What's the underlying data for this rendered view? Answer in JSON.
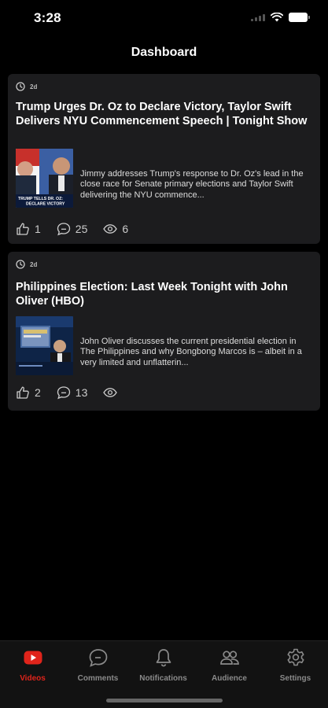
{
  "status_bar": {
    "time": "3:28"
  },
  "header": {
    "title": "Dashboard"
  },
  "videos": [
    {
      "age": "2d",
      "title": "Trump Urges Dr. Oz to Declare Victory, Taylor Swift Delivers NYU Commencement Speech | Tonight Show",
      "description": "Jimmy addresses Trump's response to Dr. Oz's lead in the close race for Senate primary elections and Taylor Swift delivering the NYU commence...",
      "thumbnail_caption": "TRUMP TELLS DR. OZ: DECLARE VICTORY",
      "likes": "1",
      "comments": "25",
      "views": "6"
    },
    {
      "age": "2d",
      "title": "Philippines Election: Last Week Tonight with John Oliver (HBO)",
      "description": "John Oliver discusses the current presidential election in The Philippines and why Bongbong Marcos is – albeit in a very limited and unflatterin...",
      "likes": "2",
      "comments": "13",
      "views": ""
    }
  ],
  "tabs": [
    {
      "label": "Videos",
      "icon": "youtube-icon",
      "active": true
    },
    {
      "label": "Comments",
      "icon": "comment-bubble-icon",
      "active": false
    },
    {
      "label": "Notifications",
      "icon": "bell-icon",
      "active": false
    },
    {
      "label": "Audience",
      "icon": "people-icon",
      "active": false
    },
    {
      "label": "Settings",
      "icon": "gear-icon",
      "active": false
    }
  ],
  "colors": {
    "accent": "#e0241b",
    "card_bg": "#1c1c1e",
    "background": "#000000",
    "muted": "#8a8a8a"
  }
}
